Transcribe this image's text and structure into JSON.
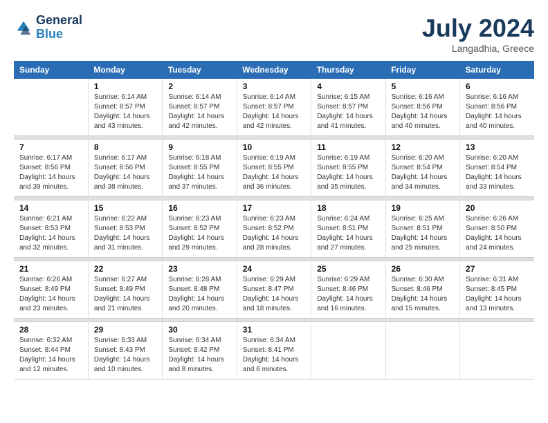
{
  "logo": {
    "line1": "General",
    "line2": "Blue"
  },
  "title": "July 2024",
  "location": "Langadhia, Greece",
  "days_header": [
    "Sunday",
    "Monday",
    "Tuesday",
    "Wednesday",
    "Thursday",
    "Friday",
    "Saturday"
  ],
  "weeks": [
    [
      {
        "date": "",
        "sunrise": "",
        "sunset": "",
        "daylight": ""
      },
      {
        "date": "1",
        "sunrise": "Sunrise: 6:14 AM",
        "sunset": "Sunset: 8:57 PM",
        "daylight": "Daylight: 14 hours and 43 minutes."
      },
      {
        "date": "2",
        "sunrise": "Sunrise: 6:14 AM",
        "sunset": "Sunset: 8:57 PM",
        "daylight": "Daylight: 14 hours and 42 minutes."
      },
      {
        "date": "3",
        "sunrise": "Sunrise: 6:14 AM",
        "sunset": "Sunset: 8:57 PM",
        "daylight": "Daylight: 14 hours and 42 minutes."
      },
      {
        "date": "4",
        "sunrise": "Sunrise: 6:15 AM",
        "sunset": "Sunset: 8:57 PM",
        "daylight": "Daylight: 14 hours and 41 minutes."
      },
      {
        "date": "5",
        "sunrise": "Sunrise: 6:16 AM",
        "sunset": "Sunset: 8:56 PM",
        "daylight": "Daylight: 14 hours and 40 minutes."
      },
      {
        "date": "6",
        "sunrise": "Sunrise: 6:16 AM",
        "sunset": "Sunset: 8:56 PM",
        "daylight": "Daylight: 14 hours and 40 minutes."
      }
    ],
    [
      {
        "date": "7",
        "sunrise": "Sunrise: 6:17 AM",
        "sunset": "Sunset: 8:56 PM",
        "daylight": "Daylight: 14 hours and 39 minutes."
      },
      {
        "date": "8",
        "sunrise": "Sunrise: 6:17 AM",
        "sunset": "Sunset: 8:56 PM",
        "daylight": "Daylight: 14 hours and 38 minutes."
      },
      {
        "date": "9",
        "sunrise": "Sunrise: 6:18 AM",
        "sunset": "Sunset: 8:55 PM",
        "daylight": "Daylight: 14 hours and 37 minutes."
      },
      {
        "date": "10",
        "sunrise": "Sunrise: 6:19 AM",
        "sunset": "Sunset: 8:55 PM",
        "daylight": "Daylight: 14 hours and 36 minutes."
      },
      {
        "date": "11",
        "sunrise": "Sunrise: 6:19 AM",
        "sunset": "Sunset: 8:55 PM",
        "daylight": "Daylight: 14 hours and 35 minutes."
      },
      {
        "date": "12",
        "sunrise": "Sunrise: 6:20 AM",
        "sunset": "Sunset: 8:54 PM",
        "daylight": "Daylight: 14 hours and 34 minutes."
      },
      {
        "date": "13",
        "sunrise": "Sunrise: 6:20 AM",
        "sunset": "Sunset: 8:54 PM",
        "daylight": "Daylight: 14 hours and 33 minutes."
      }
    ],
    [
      {
        "date": "14",
        "sunrise": "Sunrise: 6:21 AM",
        "sunset": "Sunset: 8:53 PM",
        "daylight": "Daylight: 14 hours and 32 minutes."
      },
      {
        "date": "15",
        "sunrise": "Sunrise: 6:22 AM",
        "sunset": "Sunset: 8:53 PM",
        "daylight": "Daylight: 14 hours and 31 minutes."
      },
      {
        "date": "16",
        "sunrise": "Sunrise: 6:23 AM",
        "sunset": "Sunset: 8:52 PM",
        "daylight": "Daylight: 14 hours and 29 minutes."
      },
      {
        "date": "17",
        "sunrise": "Sunrise: 6:23 AM",
        "sunset": "Sunset: 8:52 PM",
        "daylight": "Daylight: 14 hours and 28 minutes."
      },
      {
        "date": "18",
        "sunrise": "Sunrise: 6:24 AM",
        "sunset": "Sunset: 8:51 PM",
        "daylight": "Daylight: 14 hours and 27 minutes."
      },
      {
        "date": "19",
        "sunrise": "Sunrise: 6:25 AM",
        "sunset": "Sunset: 8:51 PM",
        "daylight": "Daylight: 14 hours and 25 minutes."
      },
      {
        "date": "20",
        "sunrise": "Sunrise: 6:26 AM",
        "sunset": "Sunset: 8:50 PM",
        "daylight": "Daylight: 14 hours and 24 minutes."
      }
    ],
    [
      {
        "date": "21",
        "sunrise": "Sunrise: 6:26 AM",
        "sunset": "Sunset: 8:49 PM",
        "daylight": "Daylight: 14 hours and 23 minutes."
      },
      {
        "date": "22",
        "sunrise": "Sunrise: 6:27 AM",
        "sunset": "Sunset: 8:49 PM",
        "daylight": "Daylight: 14 hours and 21 minutes."
      },
      {
        "date": "23",
        "sunrise": "Sunrise: 6:28 AM",
        "sunset": "Sunset: 8:48 PM",
        "daylight": "Daylight: 14 hours and 20 minutes."
      },
      {
        "date": "24",
        "sunrise": "Sunrise: 6:29 AM",
        "sunset": "Sunset: 8:47 PM",
        "daylight": "Daylight: 14 hours and 18 minutes."
      },
      {
        "date": "25",
        "sunrise": "Sunrise: 6:29 AM",
        "sunset": "Sunset: 8:46 PM",
        "daylight": "Daylight: 14 hours and 16 minutes."
      },
      {
        "date": "26",
        "sunrise": "Sunrise: 6:30 AM",
        "sunset": "Sunset: 8:46 PM",
        "daylight": "Daylight: 14 hours and 15 minutes."
      },
      {
        "date": "27",
        "sunrise": "Sunrise: 6:31 AM",
        "sunset": "Sunset: 8:45 PM",
        "daylight": "Daylight: 14 hours and 13 minutes."
      }
    ],
    [
      {
        "date": "28",
        "sunrise": "Sunrise: 6:32 AM",
        "sunset": "Sunset: 8:44 PM",
        "daylight": "Daylight: 14 hours and 12 minutes."
      },
      {
        "date": "29",
        "sunrise": "Sunrise: 6:33 AM",
        "sunset": "Sunset: 8:43 PM",
        "daylight": "Daylight: 14 hours and 10 minutes."
      },
      {
        "date": "30",
        "sunrise": "Sunrise: 6:34 AM",
        "sunset": "Sunset: 8:42 PM",
        "daylight": "Daylight: 14 hours and 8 minutes."
      },
      {
        "date": "31",
        "sunrise": "Sunrise: 6:34 AM",
        "sunset": "Sunset: 8:41 PM",
        "daylight": "Daylight: 14 hours and 6 minutes."
      },
      {
        "date": "",
        "sunrise": "",
        "sunset": "",
        "daylight": ""
      },
      {
        "date": "",
        "sunrise": "",
        "sunset": "",
        "daylight": ""
      },
      {
        "date": "",
        "sunrise": "",
        "sunset": "",
        "daylight": ""
      }
    ]
  ]
}
